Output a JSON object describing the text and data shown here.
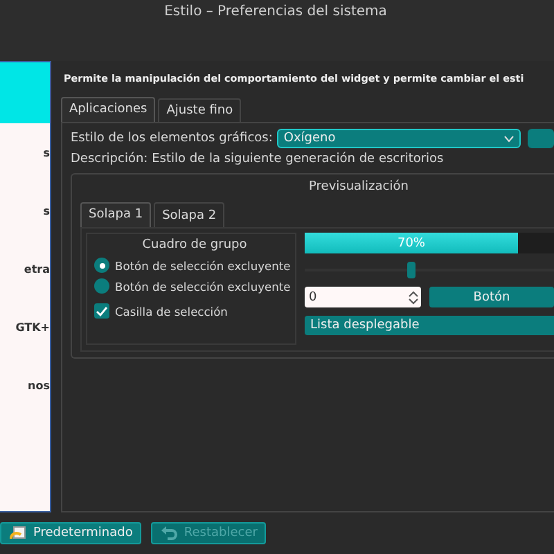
{
  "window": {
    "title": "Estilo – Preferencias del sistema"
  },
  "sidebar": {
    "items": [
      {
        "selected": true
      },
      {
        "label": "s",
        "selected": false
      },
      {
        "label": "s",
        "selected": false
      },
      {
        "label": "etra",
        "selected": false
      },
      {
        "label": "GTK+",
        "selected": false
      },
      {
        "label": "nos",
        "selected": false
      }
    ]
  },
  "header": "Permite la manipulación del comportamiento del widget y permite cambiar el esti",
  "tabs": [
    {
      "label": "Aplicaciones",
      "selected": true
    },
    {
      "label": "Ajuste fino",
      "selected": false
    }
  ],
  "style_row": {
    "label": "Estilo de los elementos gráficos:",
    "value": "Oxígeno"
  },
  "description": "Descripción: Estilo de la siguiente generación de escritorios",
  "preview": {
    "title": "Previsualización",
    "tabs": [
      {
        "label": "Solapa 1",
        "selected": true
      },
      {
        "label": "Solapa 2",
        "selected": false
      }
    ],
    "group": {
      "title": "Cuadro de grupo",
      "radios": [
        {
          "label": "Botón de selección excluyente",
          "selected": true
        },
        {
          "label": "Botón de selección excluyente",
          "selected": false
        }
      ],
      "checkbox": {
        "label": "Casilla de selección",
        "checked": true
      }
    },
    "progress": {
      "level": 0.7,
      "text": "70%"
    },
    "slider": {
      "level": 0.35
    },
    "spinbox": {
      "value": "0"
    },
    "button": "Botón",
    "combo": "Lista desplegable"
  },
  "footer": [
    {
      "label": "Predeterminado",
      "disabled": false
    },
    {
      "label": "Restablecer",
      "disabled": true
    }
  ]
}
